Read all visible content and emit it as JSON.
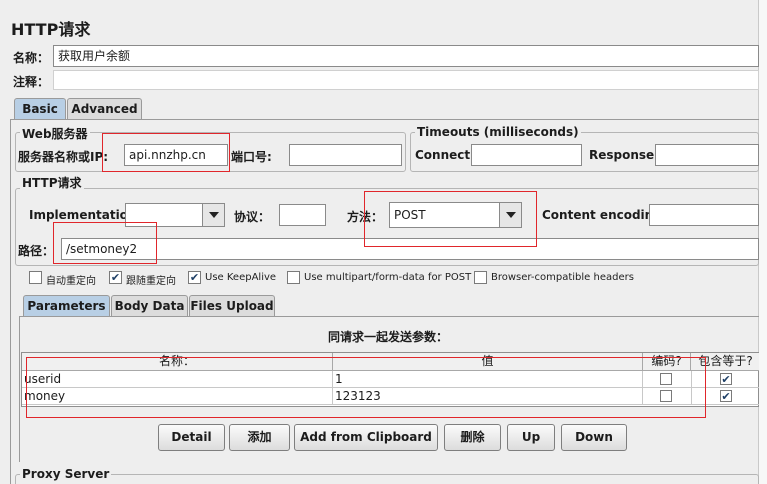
{
  "panel": {
    "title": "HTTP请求"
  },
  "name_label": "名称：",
  "name_value": "获取用户余额",
  "comment_label": "注释：",
  "top_tabs": {
    "basic": "Basic",
    "advanced": "Advanced"
  },
  "web_server": {
    "group_title": "Web服务器",
    "host_label": "服务器名称或IP:",
    "host_value": "api.nnzhp.cn",
    "port_label": "端口号:",
    "port_value": ""
  },
  "timeouts": {
    "group_title": "Timeouts (milliseconds)",
    "connect_label": "Connect:",
    "response_label": "Response:"
  },
  "http_request": {
    "group_title": "HTTP请求",
    "implementation_label": "Implementation:",
    "implementation_value": "",
    "protocol_label": "协议：",
    "protocol_value": "",
    "method_label": "方法：",
    "method_value": "POST",
    "encoding_label": "Content encoding:",
    "path_label": "路径：",
    "path_value": "/setmoney2"
  },
  "options": [
    {
      "label": "自动重定向",
      "checked": false
    },
    {
      "label": "跟随重定向",
      "checked": true
    },
    {
      "label": "Use KeepAlive",
      "checked": true
    },
    {
      "label": "Use multipart/form-data for POST",
      "checked": false
    },
    {
      "label": "Browser-compatible headers",
      "checked": false
    }
  ],
  "sub_tabs": {
    "parameters": "Parameters",
    "body_data": "Body Data",
    "files_upload": "Files Upload"
  },
  "params_table": {
    "caption": "同请求一起发送参数：",
    "headers": {
      "name": "名称：",
      "value": "值",
      "encode": "编码?",
      "include_equals": "包含等于?"
    },
    "rows": [
      {
        "name": "userid",
        "value": "1",
        "encode": false,
        "include_equals": true
      },
      {
        "name": "money",
        "value": "123123",
        "encode": false,
        "include_equals": true
      }
    ]
  },
  "buttons": {
    "detail": "Detail",
    "add": "添加",
    "add_clipboard": "Add from Clipboard",
    "delete": "删除",
    "up": "Up",
    "down": "Down"
  },
  "proxy": {
    "group_title": "Proxy Server"
  },
  "colors": {
    "annotation_red": "#e0262b",
    "active_tab": "#b8cfe5",
    "panel_bg": "#eeeeee"
  }
}
